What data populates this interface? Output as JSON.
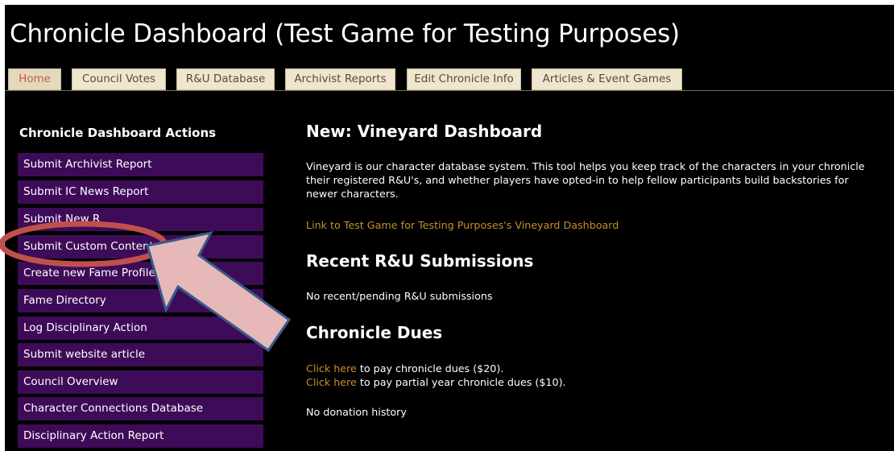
{
  "page": {
    "title": "Chronicle Dashboard (Test Game for Testing Purposes)"
  },
  "tabs": [
    {
      "label": "Home",
      "active": true
    },
    {
      "label": "Council Votes"
    },
    {
      "label": "R&U Database"
    },
    {
      "label": "Archivist Reports"
    },
    {
      "label": "Edit Chronicle Info"
    },
    {
      "label": "Articles & Event Games"
    }
  ],
  "sidebar": {
    "heading": "Chronicle Dashboard Actions",
    "items": [
      {
        "label": "Submit Archivist Report"
      },
      {
        "label": "Submit IC News Report"
      },
      {
        "label": "Submit New R"
      },
      {
        "label": "Submit Custom Content"
      },
      {
        "label": "Create new Fame Profile"
      },
      {
        "label": "Fame Directory"
      },
      {
        "label": "Log Disciplinary Action"
      },
      {
        "label": "Submit website article"
      },
      {
        "label": "Council Overview"
      },
      {
        "label": "Character Connections Database"
      },
      {
        "label": "Disciplinary Action Report"
      }
    ]
  },
  "main": {
    "vineyard": {
      "heading": "New: Vineyard Dashboard",
      "line1": "Vineyard is our character database system. This tool helps you keep track of the characters in your chronicle",
      "line2": "their registered R&U's, and whether players have opted-in to help fellow participants build backstories for",
      "line3": "newer characters.",
      "link": "Link to Test Game for Testing Purposes's Vineyard Dashboard"
    },
    "submissions": {
      "heading": "Recent R&U Submissions",
      "text": "No recent/pending R&U submissions"
    },
    "dues": {
      "heading": "Chronicle Dues",
      "link1": "Click here",
      "text1": " to pay chronicle dues ($20).",
      "link2": "Click here",
      "text2": " to pay partial year chronicle dues ($10).",
      "donation": "No donation history"
    }
  },
  "annotation": {
    "ellipse_color": "#c0504d",
    "arrow_fill": "#e6b9b8",
    "arrow_stroke": "#3a5a8c"
  }
}
